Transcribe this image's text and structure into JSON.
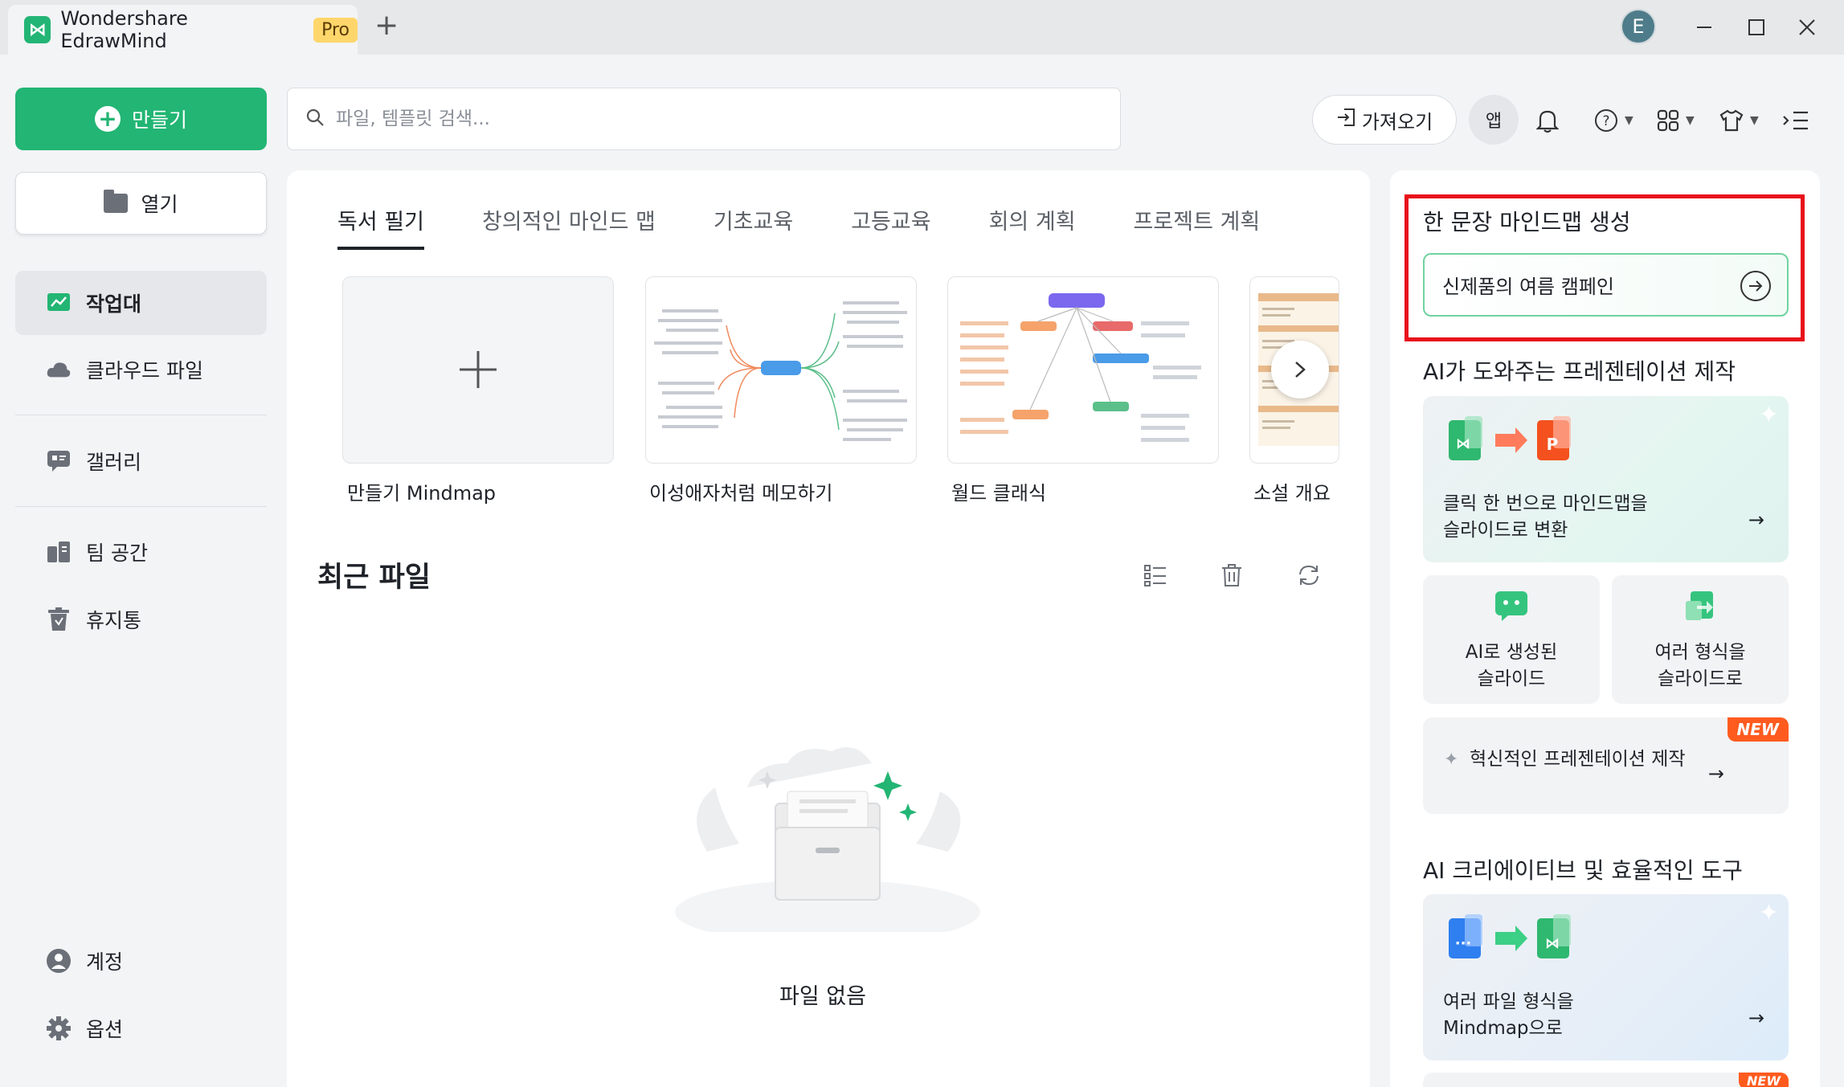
{
  "app": {
    "title": "Wondershare EdrawMind",
    "badge": "Pro",
    "new_tab": "+",
    "avatar_letter": "E"
  },
  "window_controls": [
    "minimize-icon",
    "maximize-icon",
    "close-icon"
  ],
  "sidebar": {
    "create_label": "만들기",
    "open_label": "열기",
    "items": [
      {
        "label": "작업대",
        "icon": "workbench-icon",
        "active": true
      },
      {
        "label": "클라우드 파일",
        "icon": "cloud-icon"
      },
      {
        "label": "갤러리",
        "icon": "gallery-icon"
      },
      {
        "label": "팀 공간",
        "icon": "team-icon"
      },
      {
        "label": "휴지통",
        "icon": "trash-icon"
      }
    ],
    "bottom": [
      {
        "label": "계정",
        "icon": "account-icon"
      },
      {
        "label": "옵션",
        "icon": "gear-icon"
      }
    ]
  },
  "search": {
    "placeholder": "파일, 템플릿 검색..."
  },
  "toolbar": {
    "import_label": "가져오기",
    "app_label": "앱",
    "icons": [
      "bell-icon",
      "help-icon",
      "grid-apps-icon",
      "shirt-theme-icon",
      "menu-collapse-icon"
    ]
  },
  "template_tabs": [
    "독서 필기",
    "창의적인 마인드 맵",
    "기초교육",
    "고등교육",
    "회의 계획",
    "프로젝트 계획"
  ],
  "templates": [
    {
      "label": "만들기 Mindmap"
    },
    {
      "label": "이성애자처럼 메모하기"
    },
    {
      "label": "월드 클래식"
    },
    {
      "label": "소설 개요"
    }
  ],
  "recent": {
    "title": "최근 파일",
    "empty_text": "파일 없음"
  },
  "right_panel": {
    "section1_title": "한 문장 마인드맵 생성",
    "prompt_text": "신제품의 여름 캠페인",
    "section2_title": "AI가 도와주는 프레젠테이션 제작",
    "card_convert_line1": "클릭 한 번으로 마인드맵을",
    "card_convert_line2": "슬라이드로 변환",
    "card_ai_slides_line1": "AI로 생성된",
    "card_ai_slides_line2": "슬라이드",
    "card_formats_line1": "여러 형식을",
    "card_formats_line2": "슬라이드로",
    "new_badge": "NEW",
    "card_innovative": "혁신적인 프레젠테이션 제작",
    "section3_title": "AI 크리에이티브 및 효율적인 도구",
    "card_files_line1": "여러 파일 형식을",
    "card_files_line2": "Mindmap으로",
    "arrow": "→"
  },
  "colors": {
    "brand_green": "#22b573",
    "highlight_red": "#e8101a",
    "new_orange": "#ff5b1f",
    "pro_yellow": "#ffd66b"
  }
}
